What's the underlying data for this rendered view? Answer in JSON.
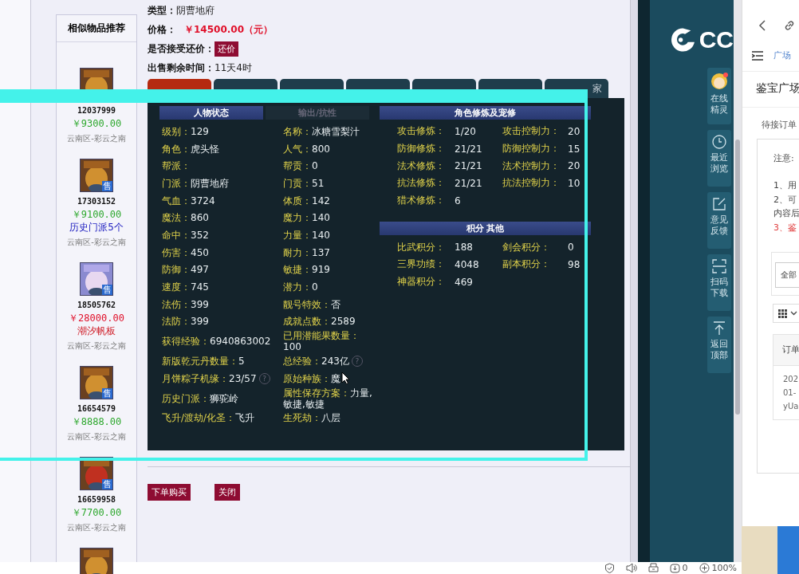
{
  "sidebar": {
    "title": "相似物品推荐",
    "items": [
      {
        "kind": "full",
        "id": "12037999",
        "price": "￥9300.00",
        "color": "#2ea82e",
        "region": "云南区-彩云之南"
      },
      {
        "kind": "full",
        "badge": "售",
        "id": "17303152",
        "price": "￥9100.00",
        "color": "#2ea82e",
        "note": {
          "text": "历史门派5个",
          "color": "#2020c0"
        },
        "region": "云南区-彩云之南"
      },
      {
        "kind": "full",
        "badge": "售",
        "id": "18505762",
        "price": "￥28000.00",
        "color": "#e0102a",
        "note": {
          "text": "潮汐帆板",
          "color": "#d0202a"
        },
        "region": "云南区-彩云之南"
      },
      {
        "kind": "full",
        "badge": "售",
        "id": "16654579",
        "price": "￥8888.00",
        "color": "#2ea82e",
        "region": "云南区-彩云之南"
      },
      {
        "kind": "full",
        "badge": "售",
        "id": "16659958",
        "price": "￥7700.00",
        "color": "#2ea82e",
        "region": "云南区-彩云之南"
      },
      {
        "kind": "avatar-only"
      }
    ]
  },
  "info": [
    {
      "kind": "text",
      "label": "类型：",
      "value": "阴曹地府"
    },
    {
      "kind": "price",
      "label": "价格：",
      "value": "￥14500.00（元）"
    },
    {
      "kind": "button",
      "label": "是否接受还价：",
      "value": "还价"
    },
    {
      "kind": "text",
      "label": "出售剩余时间：",
      "value": "11天4时"
    }
  ],
  "tabs": [
    {
      "selected": true
    },
    {
      "selected": false
    },
    {
      "selected": false
    },
    {
      "selected": false
    },
    {
      "selected": false
    },
    {
      "selected": false
    },
    {
      "selected": false,
      "label": "家"
    }
  ],
  "status_tabs": [
    {
      "label": "人物状态",
      "selected": true
    },
    {
      "label": "输出/抗性",
      "selected": false
    }
  ],
  "status_rows": [
    [
      {
        "label": "级别：",
        "value": "129"
      },
      {
        "label": "名称：",
        "value": "冰糖雪梨汁"
      }
    ],
    [
      {
        "label": "角色：",
        "value": "虎头怪"
      },
      {
        "label": "人气：",
        "value": "800"
      }
    ],
    [
      {
        "label": "帮派："
      },
      {
        "label": "帮贡：",
        "value": "0"
      }
    ],
    [
      {
        "label": "门派：",
        "value": "阴曹地府"
      },
      {
        "label": "门贡：",
        "value": "51"
      }
    ],
    [
      {
        "label": "气血：",
        "value": "3724"
      },
      {
        "label": "体质：",
        "value": "142"
      }
    ],
    [
      {
        "label": "魔法：",
        "value": "860"
      },
      {
        "label": "魔力：",
        "value": "140"
      }
    ],
    [
      {
        "label": "命中：",
        "value": "352"
      },
      {
        "label": "力量：",
        "value": "140"
      }
    ],
    [
      {
        "label": "伤害：",
        "value": "450"
      },
      {
        "label": "耐力：",
        "value": "137"
      }
    ],
    [
      {
        "label": "防御：",
        "value": "497"
      },
      {
        "label": "敏捷：",
        "value": "919"
      }
    ],
    [
      {
        "label": "速度：",
        "value": "745"
      },
      {
        "label": "潜力：",
        "value": "0"
      }
    ],
    [
      {
        "label": "法伤：",
        "value": "399"
      },
      {
        "label": "靓号特效：",
        "value": "否"
      }
    ],
    [
      {
        "label": "法防：",
        "value": "399"
      },
      {
        "label": "成就点数：",
        "value": "2589"
      }
    ],
    [
      {
        "label": "获得经验：",
        "value": "6940863002"
      },
      {
        "label": "已用潜能果数量：",
        "value": "100"
      }
    ],
    [
      {
        "label": "新版乾元丹数量：",
        "value": "5"
      },
      {
        "label": "总经验：",
        "value": "243亿",
        "help": "?"
      }
    ],
    [
      {
        "label": "月饼粽子机缘：",
        "value": "23/57",
        "help": "?"
      },
      {
        "label": "原始种族：",
        "value": "魔"
      }
    ],
    [
      {
        "label": "历史门派：",
        "value": "狮驼岭"
      },
      {
        "label": "属性保存方案：",
        "value": "力量,敏捷,敏捷"
      }
    ],
    [
      {
        "label": "飞升/渡劫/化圣：",
        "value": "飞升"
      },
      {
        "label": "生死劫：",
        "value": "八层"
      }
    ]
  ],
  "sections": [
    {
      "title": "角色修炼及宠修",
      "rows": [
        [
          {
            "label": "攻击修炼：",
            "value": "1/20"
          },
          {
            "label": "攻击控制力：",
            "value": "20"
          }
        ],
        [
          {
            "label": "防御修炼：",
            "value": "21/21"
          },
          {
            "label": "防御控制力：",
            "value": "15"
          }
        ],
        [
          {
            "label": "法术修炼：",
            "value": "21/21"
          },
          {
            "label": "法术控制力：",
            "value": "20"
          }
        ],
        [
          {
            "label": "抗法修炼：",
            "value": "21/21"
          },
          {
            "label": "抗法控制力：",
            "value": "10"
          }
        ],
        [
          {
            "label": "猎术修炼：",
            "value": "6"
          }
        ]
      ]
    },
    {
      "title": "积分 其他",
      "rows": [
        [
          {
            "label": "比武积分：",
            "value": "188"
          },
          {
            "label": "剑会积分：",
            "value": "0"
          }
        ],
        [
          {
            "label": "三界功绩：",
            "value": "4048"
          },
          {
            "label": "副本积分：",
            "value": "98"
          }
        ],
        [
          {
            "label": "神器积分：",
            "value": "469"
          }
        ]
      ]
    }
  ],
  "actions": [
    "下单购买",
    "关闭"
  ],
  "logo": {
    "text": "CC"
  },
  "side_buttons": [
    {
      "kind": "avatar",
      "label": "在线精灵",
      "dot": true
    },
    {
      "kind": "clock",
      "label": "最近浏览"
    },
    {
      "kind": "edit",
      "label": "意见反馈"
    },
    {
      "kind": "scan",
      "label": "扫码下载"
    },
    {
      "kind": "top",
      "label": "返回顶部"
    }
  ],
  "panel": {
    "breadcrumb": "广场",
    "title": "鉴宝广场",
    "tab": "待接订单",
    "notice_title": "注意:",
    "notice_lines": [
      {
        "text": "1、用",
        "warn": false
      },
      {
        "text": "2、可",
        "warn": false
      },
      {
        "text": "内容后",
        "warn": false
      },
      {
        "text": "3、鉴",
        "warn": true
      }
    ],
    "filter": "全部",
    "table_header": "订单",
    "cell_lines": [
      "202",
      "01-",
      "yUa"
    ]
  },
  "status_bar": {
    "count": "0",
    "zoom": "100%"
  }
}
